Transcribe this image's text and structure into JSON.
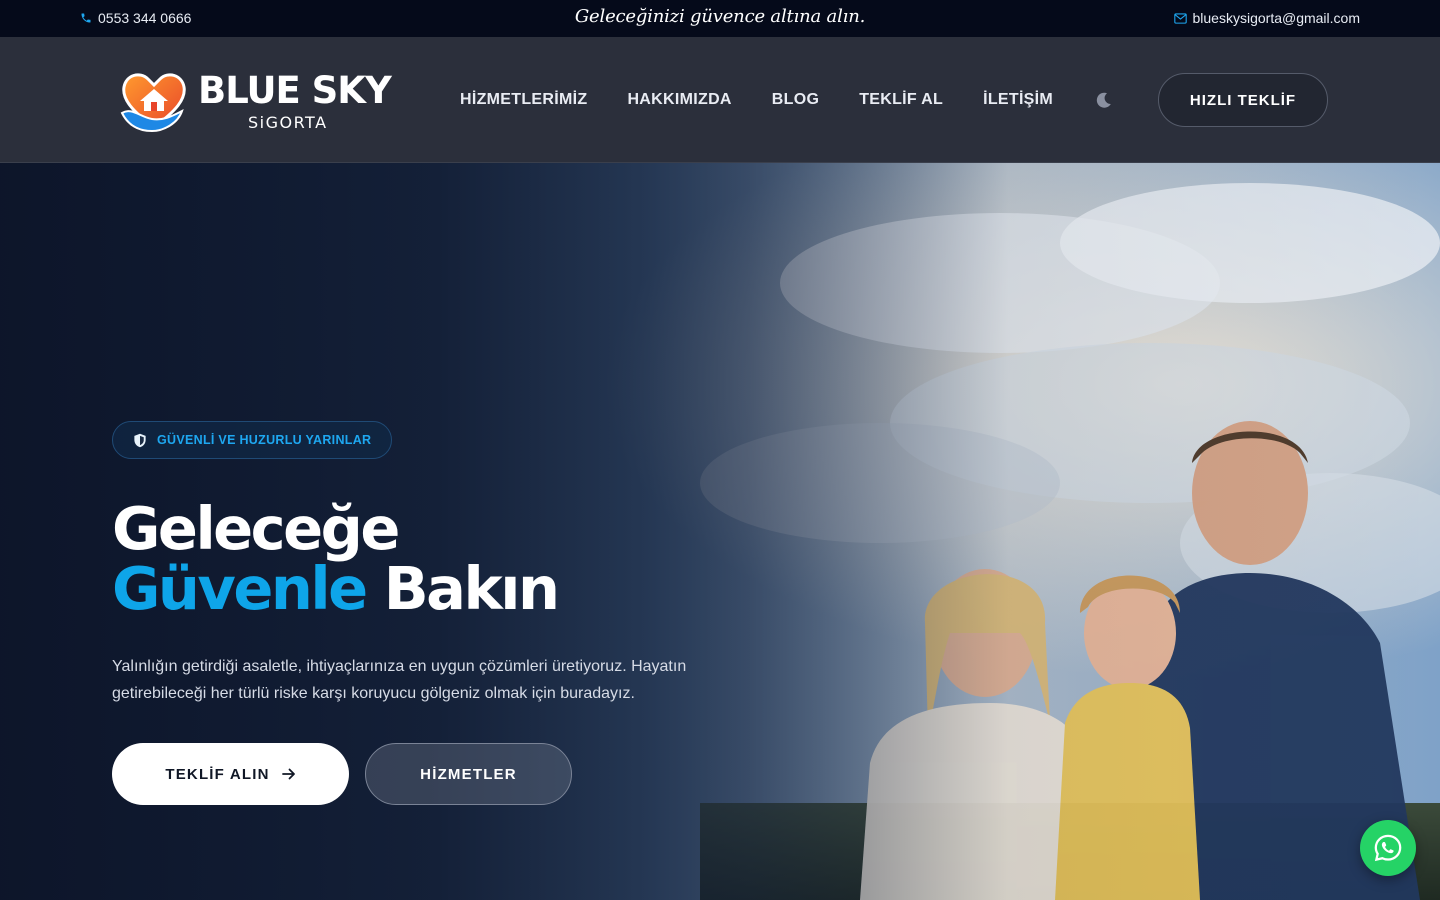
{
  "topbar": {
    "phone": "0553 344 0666",
    "tagline": "Geleceğinizi güvence altına alın.",
    "email": "blueskysigorta@gmail.com"
  },
  "logo": {
    "title": "BLUE SKY",
    "subtitle": "SiGORTA"
  },
  "nav": {
    "items": [
      {
        "label": "HİZMETLERİMİZ"
      },
      {
        "label": "HAKKIMIZDA"
      },
      {
        "label": "BLOG"
      },
      {
        "label": "TEKLİF AL"
      },
      {
        "label": "İLETİŞİM"
      }
    ],
    "theme_toggle_icon": "moon-icon",
    "cta_label": "HIZLI TEKLİF"
  },
  "hero": {
    "badge_label": "GÜVENLİ VE HUZURLU YARINLAR",
    "title_line1": "Geleceğe",
    "title_accent": "Güvenle",
    "title_rest": " Bakın",
    "description": "Yalınlığın getirdiği asaletle, ihtiyaçlarınıza en uygun çözümleri üretiyoruz. Hayatın getirebileceği her türlü riske karşı koruyucu gölgeniz olmak için buradayız.",
    "primary_button": "TEKLİF ALIN",
    "secondary_button": "HİZMETLER"
  },
  "floating": {
    "whatsapp_icon": "whatsapp-icon"
  },
  "colors": {
    "accent": "#0ea5e9",
    "topbar_bg": "#050a1a",
    "header_bg": "#2b2f3b",
    "whatsapp": "#25d366"
  }
}
